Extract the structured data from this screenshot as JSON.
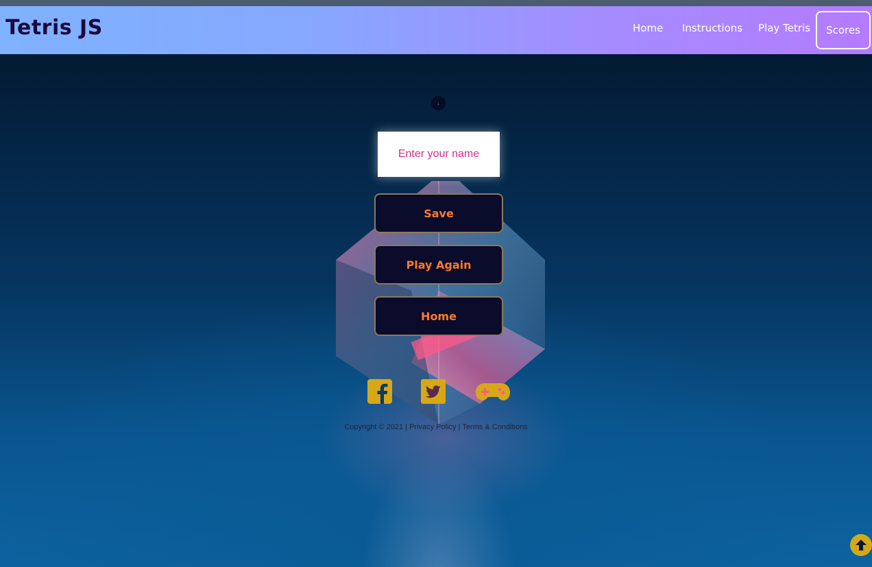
{
  "header": {
    "logo": "Tetris JS",
    "nav": [
      {
        "label": "Home"
      },
      {
        "label": "Instructions"
      },
      {
        "label": "Play Tetris"
      },
      {
        "label": "Scores"
      }
    ]
  },
  "main": {
    "score_marker": "↓",
    "name_input": {
      "placeholder": "Enter your name",
      "value": ""
    },
    "buttons": {
      "save": "Save",
      "play_again": "Play Again",
      "home": "Home"
    }
  },
  "social": [
    {
      "icon": "facebook-icon"
    },
    {
      "icon": "twitter-icon"
    },
    {
      "icon": "gamepad-icon"
    }
  ],
  "footer": {
    "copyright": "Copyright © 2021",
    "sep1": " | ",
    "privacy": "Privacy Policy",
    "sep2": " | ",
    "terms": "Terms & Conditions"
  },
  "colors": {
    "button_bg": "#0b0b2b",
    "button_text": "#ff7a2b",
    "icon_gold": "#d6a817",
    "input_text": "#d62c8a"
  }
}
